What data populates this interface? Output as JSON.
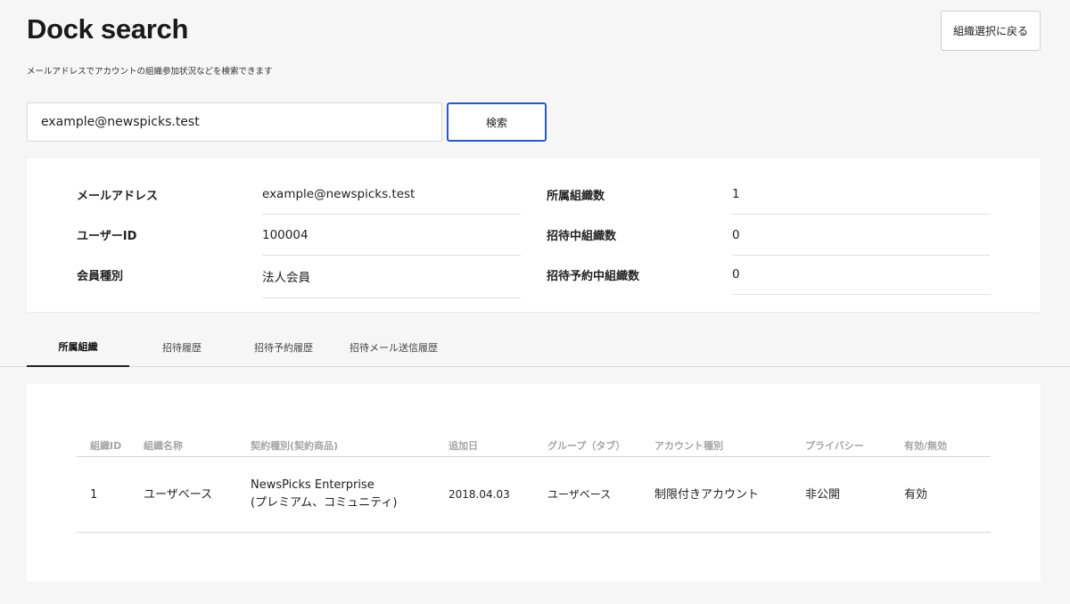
{
  "header": {
    "title": "Dock search",
    "subtitle": "メールアドレスでアカウントの組織参加状況などを検索できます",
    "back_button": "組織選択に戻る"
  },
  "search": {
    "value": "example@newspicks.test",
    "button": "検索"
  },
  "info": {
    "email_label": "メールアドレス",
    "email_value": "example@newspicks.test",
    "user_id_label": "ユーザーID",
    "user_id_value": "100004",
    "member_type_label": "会員種別",
    "member_type_value": "法人会員",
    "org_count_label": "所属組織数",
    "org_count_value": "1",
    "invite_count_label": "招待中組織数",
    "invite_count_value": "0",
    "scheduled_invite_label": "招待予約中組織数",
    "scheduled_invite_value": "0"
  },
  "tabs": [
    {
      "label": "所属組織",
      "active": true
    },
    {
      "label": "招待履歴",
      "active": false
    },
    {
      "label": "招待予約履歴",
      "active": false
    },
    {
      "label": "招待メール送信履歴",
      "active": false
    }
  ],
  "table": {
    "headers": [
      "組織ID",
      "組織名称",
      "契約種別(契約商品)",
      "追加日",
      "グループ（タブ）",
      "アカウント種別",
      "プライバシー",
      "有効/無効"
    ],
    "rows": [
      {
        "org_id": "1",
        "org_name": "ユーザベース",
        "contract_line1": "NewsPicks Enterprise",
        "contract_line2": "(プレミアム、コミュニティ)",
        "added_date": "2018.04.03",
        "group": "ユーザベース",
        "account_type": "制限付きアカウント",
        "privacy": "非公開",
        "status": "有効"
      }
    ]
  },
  "colors": {
    "accent": "#2b59c3",
    "background": "#f6f6f6"
  }
}
